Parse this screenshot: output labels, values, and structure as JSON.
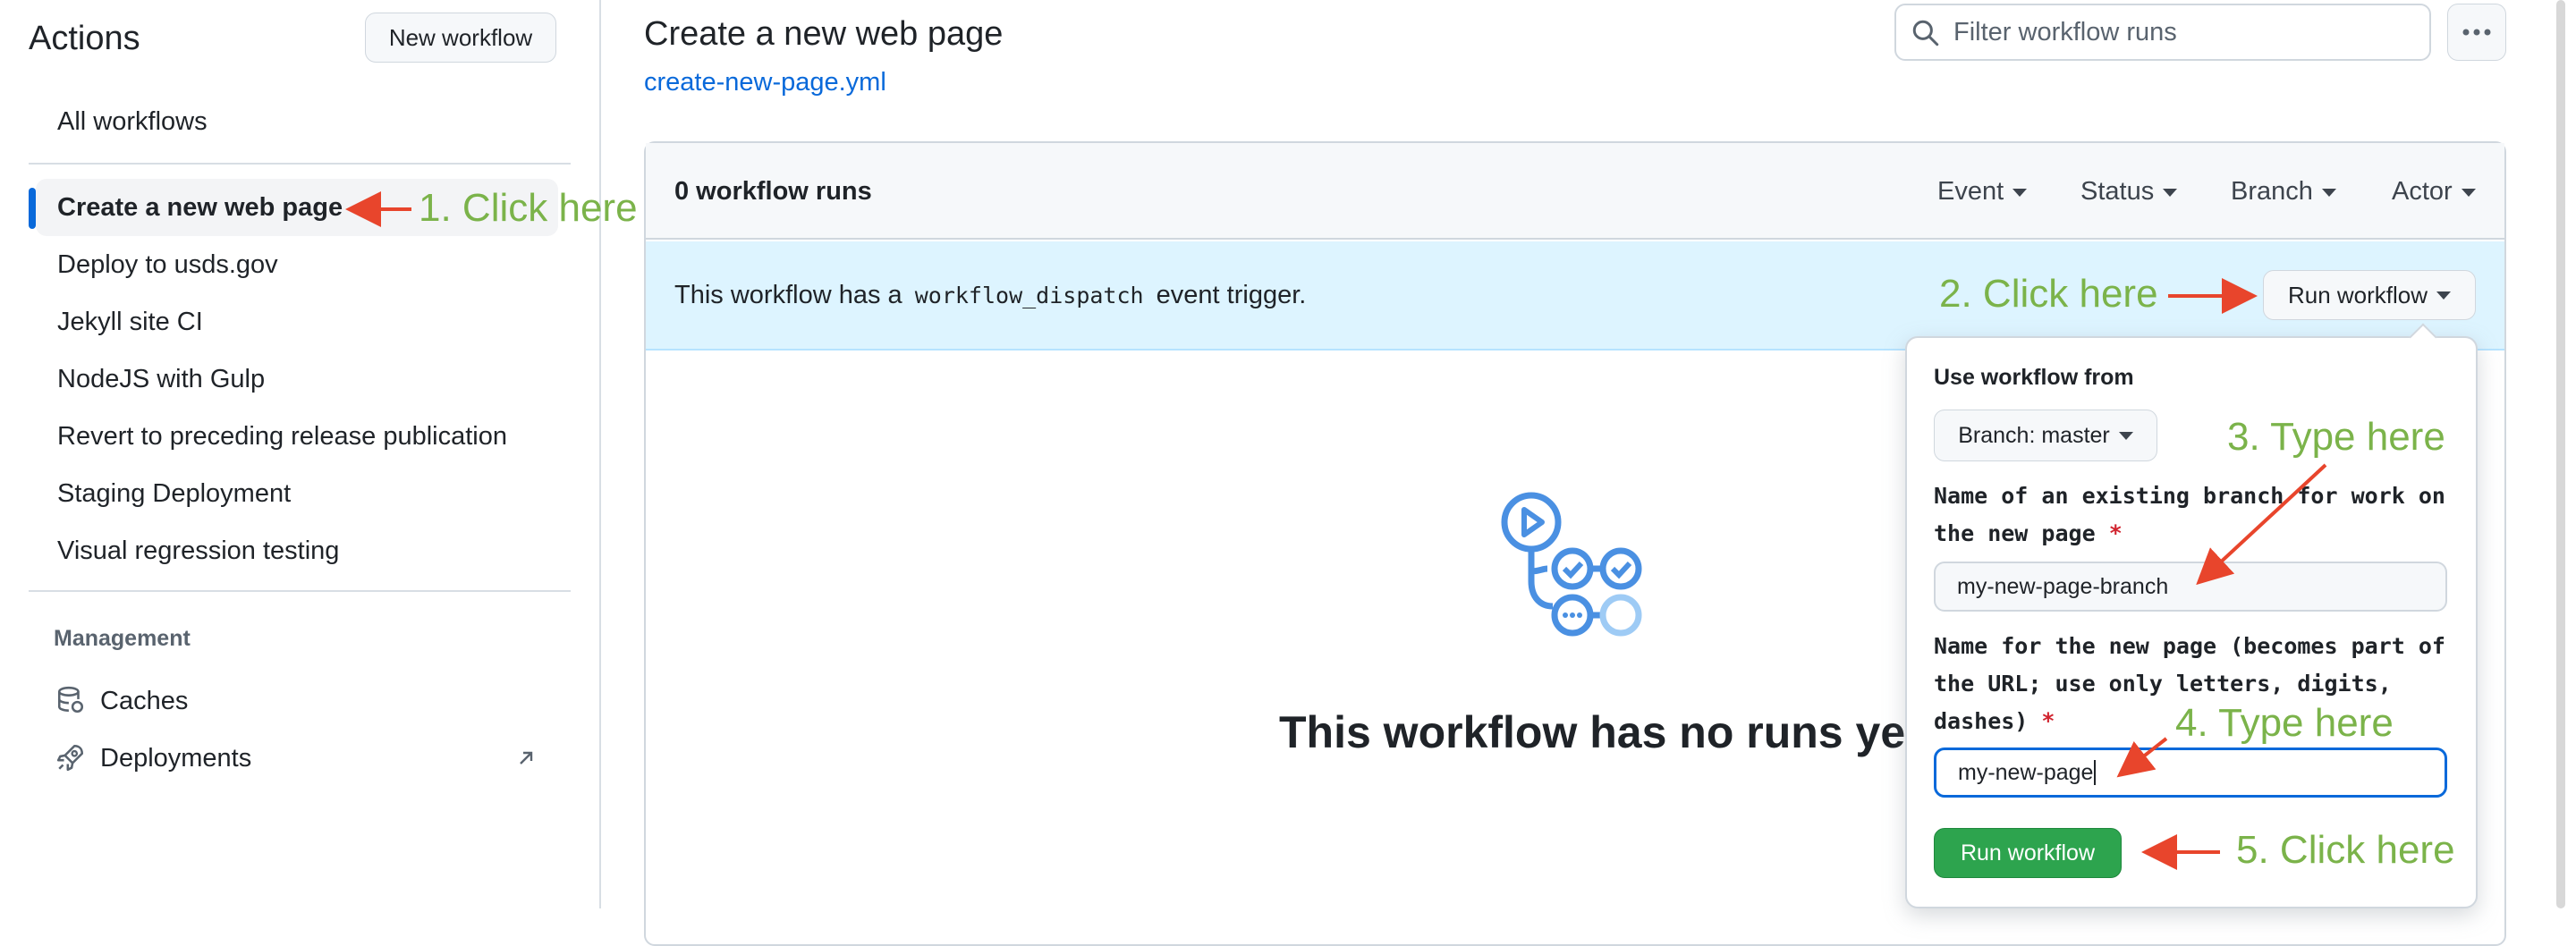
{
  "sidebar": {
    "title": "Actions",
    "new_workflow_label": "New workflow",
    "all_workflows": "All workflows",
    "items": [
      {
        "label": "Create a new web page",
        "selected": true
      },
      {
        "label": "Deploy to usds.gov"
      },
      {
        "label": "Jekyll site CI"
      },
      {
        "label": "NodeJS with Gulp"
      },
      {
        "label": "Revert to preceding release publication"
      },
      {
        "label": "Staging Deployment"
      },
      {
        "label": "Visual regression testing"
      }
    ],
    "management_heading": "Management",
    "management": [
      {
        "label": "Caches",
        "icon": "database-icon"
      },
      {
        "label": "Deployments",
        "icon": "rocket-icon",
        "external": "arrow-up-right-icon"
      }
    ]
  },
  "header": {
    "title": "Create a new web page",
    "file_link": "create-new-page.yml",
    "filter_placeholder": "Filter workflow runs",
    "more_icon": "kebab-horizontal-icon"
  },
  "runs": {
    "count_label": "0 workflow runs",
    "filters": [
      "Event",
      "Status",
      "Branch",
      "Actor"
    ],
    "dispatch_prefix": "This workflow has a",
    "dispatch_code": "workflow_dispatch",
    "dispatch_suffix": "event trigger.",
    "run_workflow_label": "Run workflow",
    "empty_title": "This workflow has no runs yet.",
    "empty_icon": "workflow-icon"
  },
  "popup": {
    "use_from": "Use workflow from",
    "branch_label": "Branch: master",
    "field1_label": "Name of an existing branch for work on the new page",
    "field1_value": "my-new-page-branch",
    "field2_label": "Name for the new page (becomes part of the URL; use only letters, digits, dashes)",
    "field2_value": "my-new-page",
    "required_mark": "*",
    "submit_label": "Run workflow"
  },
  "annotations": {
    "step1": "1. Click here",
    "step2": "2. Click here",
    "step3": "3. Type here",
    "step4": "4. Type here",
    "step5": "5. Click here",
    "color": "#7bb34a",
    "arrow_color": "#e8452c"
  },
  "colors": {
    "accent": "#0969da",
    "run_button": "#2da44e",
    "dispatch_bg": "#ddf4ff"
  }
}
